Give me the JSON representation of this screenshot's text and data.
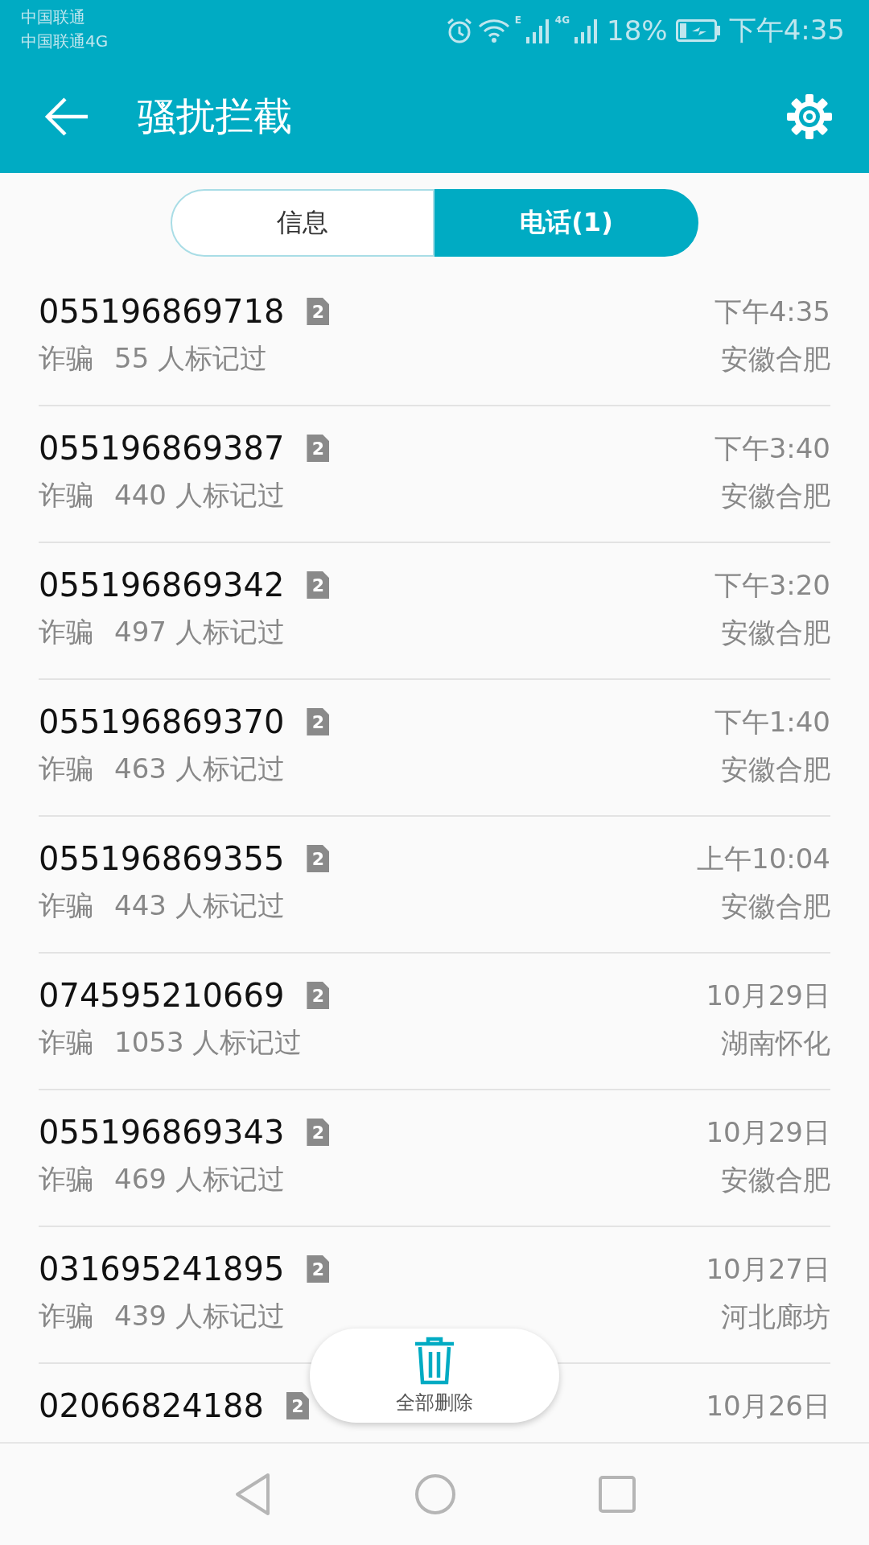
{
  "status_bar": {
    "carriers": [
      "中国联通",
      "中国联通4G"
    ],
    "network_labels": [
      "E",
      "4G"
    ],
    "battery": "18%",
    "time": "下午4:35"
  },
  "app_bar": {
    "title": "骚扰拦截"
  },
  "tabs": [
    {
      "label": "信息",
      "selected": false
    },
    {
      "label": "电话(1)",
      "selected": true
    }
  ],
  "calls": [
    {
      "number": "055196869718",
      "sim": "2",
      "tag": "诈骗",
      "marks": "55 人标记过",
      "time": "下午4:35",
      "location": "安徽合肥"
    },
    {
      "number": "055196869387",
      "sim": "2",
      "tag": "诈骗",
      "marks": "440 人标记过",
      "time": "下午3:40",
      "location": "安徽合肥"
    },
    {
      "number": "055196869342",
      "sim": "2",
      "tag": "诈骗",
      "marks": "497 人标记过",
      "time": "下午3:20",
      "location": "安徽合肥"
    },
    {
      "number": "055196869370",
      "sim": "2",
      "tag": "诈骗",
      "marks": "463 人标记过",
      "time": "下午1:40",
      "location": "安徽合肥"
    },
    {
      "number": "055196869355",
      "sim": "2",
      "tag": "诈骗",
      "marks": "443 人标记过",
      "time": "上午10:04",
      "location": "安徽合肥"
    },
    {
      "number": "074595210669",
      "sim": "2",
      "tag": "诈骗",
      "marks": "1053 人标记过",
      "time": "10月29日",
      "location": "湖南怀化"
    },
    {
      "number": "055196869343",
      "sim": "2",
      "tag": "诈骗",
      "marks": "469 人标记过",
      "time": "10月29日",
      "location": "安徽合肥"
    },
    {
      "number": "031695241895",
      "sim": "2",
      "tag": "诈骗",
      "marks": "439 人标记过",
      "time": "10月27日",
      "location": "河北廊坊"
    },
    {
      "number": "02066824188",
      "sim": "2",
      "time": "10月26日"
    }
  ],
  "delete_all_button": {
    "label": "全部删除"
  }
}
